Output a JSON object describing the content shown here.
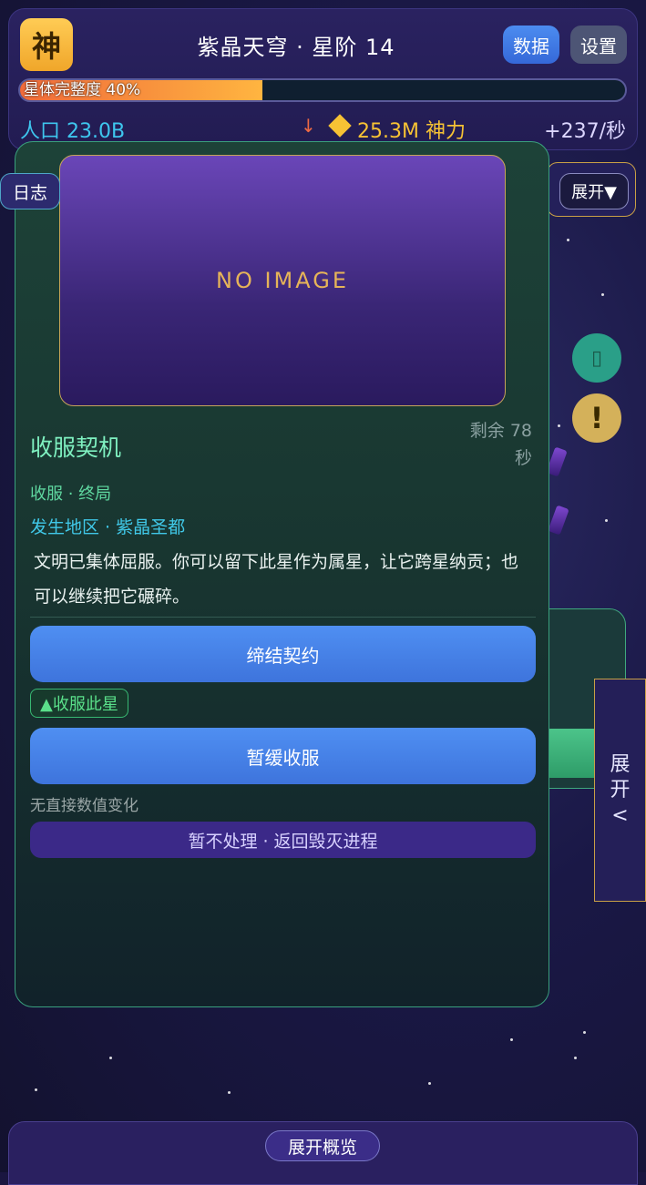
{
  "header": {
    "badge": "神",
    "title": "紫晶天穹 · 星阶 14",
    "data_button": "数据",
    "settings_button": "设置",
    "progress_label": "星体完整度 40%",
    "progress_value": 0.4,
    "population": "人口 23.0B",
    "trend_arrow": "↓",
    "divine_power": "25.3M 神力",
    "rate": "+237/秒"
  },
  "log_button": "日志",
  "right_panel": {
    "expand_button": "展开▼",
    "alert_icon": "!",
    "side_expand": [
      "展",
      "开",
      "<"
    ]
  },
  "modal": {
    "image_placeholder": "NO IMAGE",
    "title": "收服契机",
    "remaining": "剩余 78 秒",
    "tags": "收服 · 终局",
    "location": "发生地区 · 紫晶圣都",
    "description": "文明已集体屈服。你可以留下此星作为属星，让它跨星纳贡；也可以继续把它碾碎。",
    "primary_action": "缔结契约",
    "primary_effect": "▲收服此星",
    "secondary_action": "暂缓收服",
    "secondary_effect": "无直接数值变化",
    "dismiss_action": "暂不处理 · 返回毁灭进程"
  },
  "bottom": {
    "overview_button": "展开概览"
  },
  "colors": {
    "accent_gold": "#f6c234",
    "population_cyan": "#3ec6ee",
    "primary_blue": "#4f8ff2",
    "event_green": "#7ff0c0"
  }
}
